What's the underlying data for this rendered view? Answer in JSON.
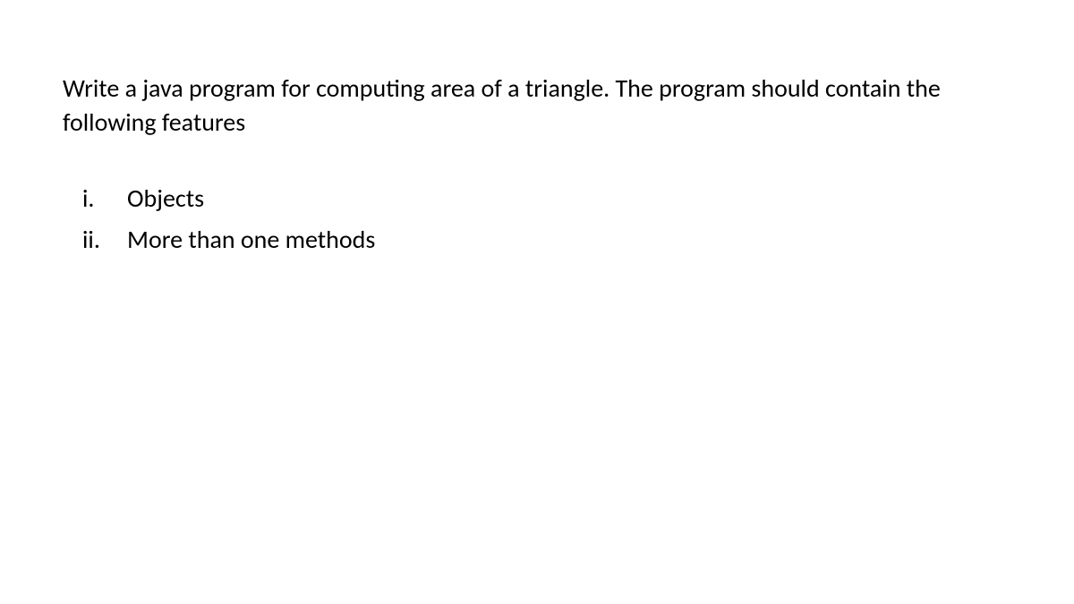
{
  "intro": "Write a java program for computing area of a triangle. The program should contain the following features",
  "items": [
    {
      "marker": "i.",
      "text": "Objects"
    },
    {
      "marker": "ii.",
      "text": "More than one methods"
    }
  ]
}
